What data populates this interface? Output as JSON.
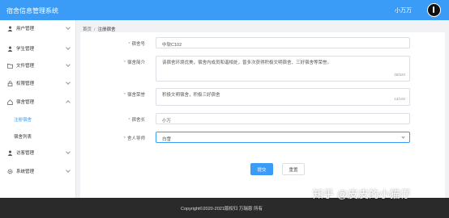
{
  "header": {
    "app_title": "宿舍信息管理系统",
    "username": "小万万"
  },
  "sidebar": {
    "items": [
      {
        "label": "用户管理",
        "icon": "user-icon"
      },
      {
        "label": "学生管理",
        "icon": "student-icon"
      },
      {
        "label": "文件管理",
        "icon": "folder-icon"
      },
      {
        "label": "权限管理",
        "icon": "lock-icon"
      },
      {
        "label": "宿舍管理",
        "icon": "dorm-icon"
      },
      {
        "label": "访客管理",
        "icon": "visitor-icon"
      },
      {
        "label": "系统管理",
        "icon": "settings-icon"
      }
    ],
    "sub_items": [
      {
        "label": "注册宿舍"
      },
      {
        "label": "宿舍列表"
      }
    ]
  },
  "breadcrumb": {
    "home": "首页",
    "separator": "/",
    "current": "注册宿舍"
  },
  "form": {
    "dorm_no": {
      "label": "宿舍号",
      "value": "中软C102"
    },
    "intro": {
      "label": "宿舍简介",
      "value": "该宿舍环境优美，宿舍内成员和谐相处，曾多次获得积极文明宿舍、三好宿舍等荣誉。",
      "counter": "38/520"
    },
    "honor": {
      "label": "宿舍荣誉",
      "value": "积极文明宿舍，积极三好宿舍",
      "counter": "13/100"
    },
    "leader": {
      "label": "宿舍长",
      "value": "小万"
    },
    "manager": {
      "label": "舍人导师",
      "value": "白雪"
    },
    "submit_label": "提交",
    "reset_label": "重置"
  },
  "footer": {
    "copyright": "Copyright©2020-2021版权归 万瑞恩 所有"
  },
  "watermark": "知乎 @皮皮的小猫仔",
  "colors": {
    "accent": "#3a9cf6",
    "footer_bg": "#2a2a2a",
    "required": "#f56c6c"
  }
}
